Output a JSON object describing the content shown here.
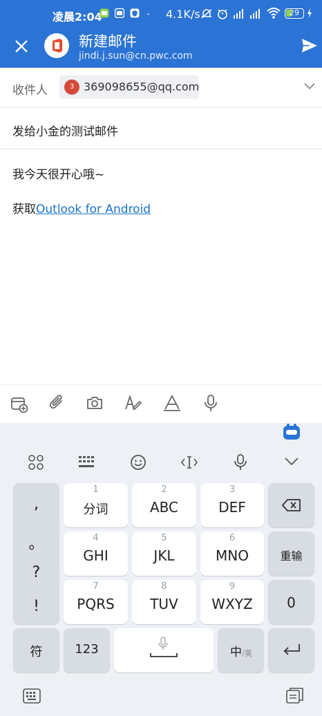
{
  "status_bar": {
    "time": "凌晨2:04",
    "speed": "4.1K/s",
    "battery": "29",
    "dot": "·"
  },
  "header": {
    "title": "新建邮件",
    "account": "jindi.j.sun@cn.pwc.com"
  },
  "compose": {
    "to_label": "收件人",
    "recipient_initial": "3",
    "recipient_email": "369098655@qq.com",
    "subject": "发给小金的测试邮件",
    "body_line": "我今天很开心哦~",
    "signature_prefix": "获取",
    "signature_link": "Outlook for Android"
  },
  "keyboard": {
    "punct": [
      ",",
      "。",
      "?",
      "!"
    ],
    "keys": [
      {
        "num": "1",
        "label": "分词"
      },
      {
        "num": "2",
        "label": "ABC"
      },
      {
        "num": "3",
        "label": "DEF"
      },
      {
        "num": "4",
        "label": "GHI"
      },
      {
        "num": "5",
        "label": "JKL"
      },
      {
        "num": "6",
        "label": "MNO"
      },
      {
        "num": "7",
        "label": "PQRS"
      },
      {
        "num": "8",
        "label": "TUV"
      },
      {
        "num": "9",
        "label": "WXYZ"
      }
    ],
    "reinput": "重输",
    "zero": "0",
    "symbols": "符",
    "numbers": "123",
    "lang_main": "中",
    "lang_alt": "/英"
  },
  "colors": {
    "header_bg": "#2b73d4",
    "link": "#1a73c9",
    "badge": "#d44a3a"
  }
}
